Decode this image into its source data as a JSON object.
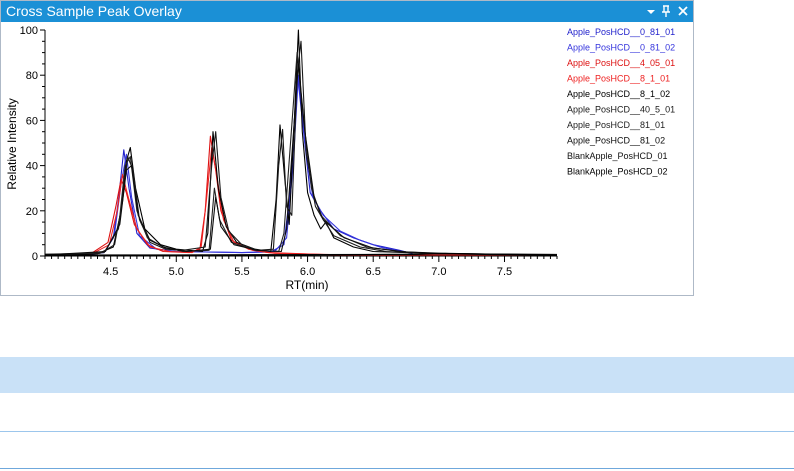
{
  "panel": {
    "title": "Cross Sample Peak Overlay",
    "icons": {
      "dropdown": "chevron-down-icon",
      "pin": "pin-icon",
      "close": "close-icon"
    }
  },
  "chart_data": {
    "type": "line",
    "xlabel": "RT(min)",
    "ylabel": "Relative Intensity",
    "xlim": [
      4.0,
      7.9
    ],
    "ylim": [
      0,
      100
    ],
    "xticks": [
      "4.5",
      "5.0",
      "5.5",
      "6.0",
      "6.5",
      "7.0",
      "7.5"
    ],
    "xtick_values": [
      4.5,
      5.0,
      5.5,
      6.0,
      6.5,
      7.0,
      7.5
    ],
    "yticks": [
      "0",
      "20",
      "40",
      "60",
      "80",
      "100"
    ],
    "ytick_values": [
      0,
      20,
      40,
      60,
      80,
      100
    ],
    "legend_position": "right",
    "series": [
      {
        "name": "Apple_PosHCD__0_81_01",
        "color": "#2222cc",
        "points": [
          [
            4.0,
            0.5
          ],
          [
            4.3,
            0.5
          ],
          [
            4.45,
            1.5
          ],
          [
            4.52,
            8
          ],
          [
            4.56,
            25
          ],
          [
            4.6,
            47
          ],
          [
            4.64,
            30
          ],
          [
            4.7,
            10
          ],
          [
            4.8,
            3.5
          ],
          [
            5.0,
            2
          ],
          [
            5.5,
            1.5
          ],
          [
            5.72,
            1.8
          ],
          [
            5.82,
            5
          ],
          [
            5.87,
            30
          ],
          [
            5.92,
            82
          ],
          [
            5.97,
            55
          ],
          [
            6.02,
            28
          ],
          [
            6.1,
            20
          ],
          [
            6.2,
            12
          ],
          [
            6.35,
            8
          ],
          [
            6.5,
            5
          ],
          [
            6.7,
            2.5
          ],
          [
            6.8,
            1
          ]
        ]
      },
      {
        "name": "Apple_PosHCD__0_81_02",
        "color": "#3535dd",
        "points": [
          [
            4.0,
            0.5
          ],
          [
            4.3,
            0.5
          ],
          [
            4.46,
            2
          ],
          [
            4.53,
            10
          ],
          [
            4.58,
            32
          ],
          [
            4.62,
            45
          ],
          [
            4.66,
            26
          ],
          [
            4.72,
            9
          ],
          [
            4.85,
            3
          ],
          [
            5.0,
            2
          ],
          [
            5.5,
            1.5
          ],
          [
            5.75,
            2
          ],
          [
            5.84,
            8
          ],
          [
            5.89,
            40
          ],
          [
            5.93,
            80
          ],
          [
            5.98,
            50
          ],
          [
            6.04,
            26
          ],
          [
            6.12,
            18
          ],
          [
            6.25,
            11
          ],
          [
            6.4,
            7
          ],
          [
            6.55,
            4
          ],
          [
            6.75,
            1.5
          ]
        ]
      },
      {
        "name": "Apple_PosHCD__4_05_01",
        "color": "#dd1111",
        "points": [
          [
            4.0,
            0.5
          ],
          [
            4.35,
            1
          ],
          [
            4.48,
            6
          ],
          [
            4.54,
            22
          ],
          [
            4.58,
            34
          ],
          [
            4.62,
            28
          ],
          [
            4.68,
            14
          ],
          [
            4.78,
            5
          ],
          [
            4.9,
            2
          ],
          [
            5.1,
            1.5
          ],
          [
            5.18,
            3
          ],
          [
            5.22,
            20
          ],
          [
            5.26,
            53
          ],
          [
            5.3,
            38
          ],
          [
            5.34,
            20
          ],
          [
            5.42,
            7
          ],
          [
            5.55,
            3
          ],
          [
            5.7,
            1.5
          ],
          [
            6.2,
            0.5
          ],
          [
            7.9,
            0.3
          ]
        ]
      },
      {
        "name": "Apple_PosHCD__8_1_01",
        "color": "#ee2222",
        "points": [
          [
            4.0,
            0.5
          ],
          [
            4.36,
            1
          ],
          [
            4.49,
            5
          ],
          [
            4.55,
            20
          ],
          [
            4.59,
            36
          ],
          [
            4.63,
            27
          ],
          [
            4.7,
            12
          ],
          [
            4.8,
            4
          ],
          [
            4.95,
            2
          ],
          [
            5.12,
            1.5
          ],
          [
            5.19,
            4
          ],
          [
            5.23,
            25
          ],
          [
            5.27,
            48
          ],
          [
            5.31,
            35
          ],
          [
            5.36,
            16
          ],
          [
            5.44,
            6
          ],
          [
            5.58,
            2.5
          ],
          [
            5.75,
            1.2
          ],
          [
            6.3,
            0.5
          ],
          [
            7.9,
            0.3
          ]
        ]
      },
      {
        "name": "Apple_PosHCD__8_1_02",
        "color": "#000000",
        "points": [
          [
            4.0,
            0.5
          ],
          [
            4.4,
            1
          ],
          [
            4.52,
            4
          ],
          [
            4.58,
            20
          ],
          [
            4.62,
            42
          ],
          [
            4.65,
            48
          ],
          [
            4.69,
            30
          ],
          [
            4.76,
            12
          ],
          [
            4.88,
            5
          ],
          [
            5.0,
            3
          ],
          [
            5.2,
            2
          ],
          [
            5.24,
            10
          ],
          [
            5.28,
            55
          ],
          [
            5.32,
            30
          ],
          [
            5.38,
            13
          ],
          [
            5.46,
            6
          ],
          [
            5.6,
            3
          ],
          [
            5.72,
            2
          ],
          [
            5.76,
            25
          ],
          [
            5.79,
            58
          ],
          [
            5.83,
            32
          ],
          [
            5.86,
            14
          ],
          [
            5.9,
            60
          ],
          [
            5.93,
            100
          ],
          [
            5.96,
            55
          ],
          [
            6.0,
            28
          ],
          [
            6.05,
            18
          ],
          [
            6.1,
            12
          ],
          [
            6.14,
            15
          ],
          [
            6.2,
            8
          ],
          [
            6.35,
            4
          ],
          [
            6.5,
            2
          ],
          [
            6.75,
            1.5
          ],
          [
            7.0,
            1
          ],
          [
            7.9,
            0.6
          ]
        ]
      },
      {
        "name": "Apple_PosHCD__40_5_01",
        "color": "#1a1a1a",
        "points": [
          [
            4.0,
            0.8
          ],
          [
            4.42,
            1.2
          ],
          [
            4.53,
            5
          ],
          [
            4.59,
            24
          ],
          [
            4.63,
            44
          ],
          [
            4.67,
            38
          ],
          [
            4.72,
            16
          ],
          [
            4.8,
            6
          ],
          [
            4.92,
            3
          ],
          [
            5.05,
            2.5
          ],
          [
            5.22,
            4
          ],
          [
            5.27,
            40
          ],
          [
            5.3,
            55
          ],
          [
            5.34,
            26
          ],
          [
            5.4,
            11
          ],
          [
            5.5,
            5
          ],
          [
            5.62,
            2.5
          ],
          [
            5.74,
            3
          ],
          [
            5.78,
            40
          ],
          [
            5.81,
            56
          ],
          [
            5.84,
            22
          ],
          [
            5.88,
            18
          ],
          [
            5.92,
            80
          ],
          [
            5.95,
            95
          ],
          [
            5.99,
            45
          ],
          [
            6.06,
            22
          ],
          [
            6.12,
            16
          ],
          [
            6.2,
            9
          ],
          [
            6.4,
            4
          ],
          [
            6.6,
            2
          ],
          [
            6.9,
            1.2
          ],
          [
            7.4,
            0.8
          ],
          [
            7.9,
            0.7
          ]
        ]
      },
      {
        "name": "Apple_PosHCD__81_01",
        "color": "#222222",
        "points": [
          [
            4.0,
            0.5
          ],
          [
            4.45,
            1.5
          ],
          [
            4.56,
            12
          ],
          [
            4.61,
            40
          ],
          [
            4.65,
            44
          ],
          [
            4.7,
            20
          ],
          [
            4.78,
            8
          ],
          [
            4.9,
            4
          ],
          [
            5.05,
            2
          ],
          [
            5.25,
            2.5
          ],
          [
            5.29,
            30
          ],
          [
            5.33,
            16
          ],
          [
            5.42,
            6
          ],
          [
            5.6,
            2.5
          ],
          [
            5.78,
            2
          ],
          [
            5.82,
            10
          ],
          [
            5.92,
            90
          ],
          [
            5.97,
            60
          ],
          [
            6.03,
            30
          ],
          [
            6.1,
            18
          ],
          [
            6.25,
            9
          ],
          [
            6.45,
            4
          ],
          [
            6.7,
            2
          ],
          [
            7.0,
            1
          ],
          [
            7.9,
            0.5
          ]
        ]
      },
      {
        "name": "Apple_PosHCD__81_02",
        "color": "#0d0d0d",
        "points": [
          [
            4.0,
            0.5
          ],
          [
            4.46,
            2
          ],
          [
            4.57,
            14
          ],
          [
            4.62,
            38
          ],
          [
            4.66,
            40
          ],
          [
            4.71,
            18
          ],
          [
            4.8,
            7
          ],
          [
            4.92,
            3.5
          ],
          [
            5.08,
            2
          ],
          [
            5.26,
            3
          ],
          [
            5.3,
            26
          ],
          [
            5.34,
            13
          ],
          [
            5.44,
            5
          ],
          [
            5.62,
            2.5
          ],
          [
            5.8,
            2
          ],
          [
            5.84,
            12
          ],
          [
            5.93,
            85
          ],
          [
            5.98,
            55
          ],
          [
            6.05,
            26
          ],
          [
            6.12,
            16
          ],
          [
            6.28,
            8
          ],
          [
            6.5,
            3.5
          ],
          [
            6.75,
            1.8
          ],
          [
            7.1,
            1
          ],
          [
            7.9,
            0.5
          ]
        ]
      },
      {
        "name": "BlankApple_PosHCD_01",
        "color": "#111111",
        "points": [
          [
            4.0,
            0.4
          ],
          [
            5.0,
            0.5
          ],
          [
            6.0,
            0.6
          ],
          [
            6.8,
            0.7
          ],
          [
            7.0,
            1.0
          ],
          [
            7.4,
            0.6
          ],
          [
            7.9,
            0.5
          ]
        ]
      },
      {
        "name": "BlankApple_PosHCD_02",
        "color": "#000000",
        "points": [
          [
            4.0,
            0.4
          ],
          [
            5.0,
            0.4
          ],
          [
            6.0,
            0.5
          ],
          [
            6.85,
            0.8
          ],
          [
            7.05,
            1.2
          ],
          [
            7.5,
            0.7
          ],
          [
            7.9,
            0.5
          ]
        ]
      }
    ]
  }
}
